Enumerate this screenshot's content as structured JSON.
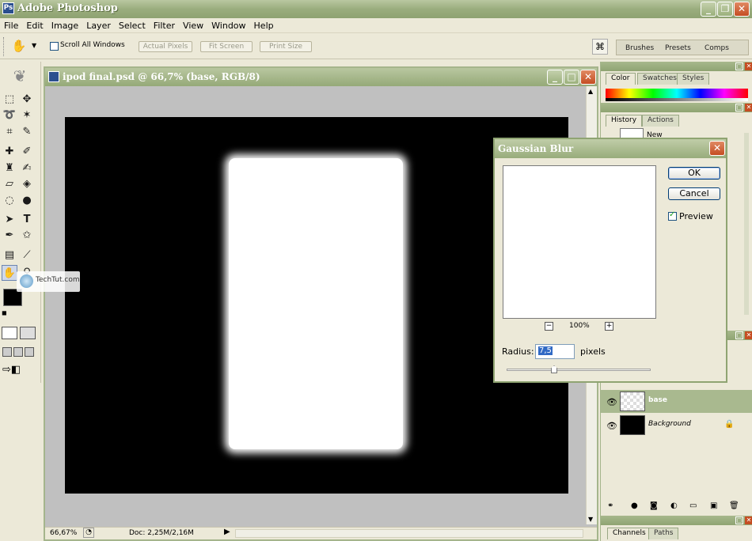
{
  "app": {
    "title": "Adobe Photoshop",
    "logo": "Ps"
  },
  "menu": [
    "File",
    "Edit",
    "Image",
    "Layer",
    "Select",
    "Filter",
    "View",
    "Window",
    "Help"
  ],
  "options": {
    "scroll_all": "Scroll All Windows",
    "actual_pixels": "Actual Pixels",
    "fit_screen": "Fit Screen",
    "print_size": "Print Size",
    "wells": [
      "Brushes",
      "Presets",
      "Comps"
    ]
  },
  "document": {
    "title": "ipod final.psd @ 66,7% (base, RGB/8)",
    "zoom": "66,67%",
    "doc_size": "Doc: 2,25M/2,16M"
  },
  "watermark": "TechTut.com",
  "panels": {
    "color_tabs": [
      "Color",
      "Swatches",
      "Styles"
    ],
    "history_tabs": [
      "History",
      "Actions"
    ],
    "history_items": [
      "New"
    ],
    "layers": [
      {
        "name": "base",
        "selected": true
      },
      {
        "name": "Background",
        "selected": false
      }
    ],
    "channels_tabs": [
      "Channels",
      "Paths"
    ]
  },
  "dialog": {
    "title": "Gaussian Blur",
    "ok": "OK",
    "cancel": "Cancel",
    "preview_label": "Preview",
    "preview_checked": true,
    "zoom": "100%",
    "zoom_out": "−",
    "zoom_in": "+",
    "radius_label": "Radius:",
    "radius_value": "7,5",
    "radius_unit": "pixels"
  },
  "colors": {
    "title_green": "#9aad7e",
    "close_red": "#c54d22",
    "foreground": "#000000",
    "background": "#ffffff"
  }
}
